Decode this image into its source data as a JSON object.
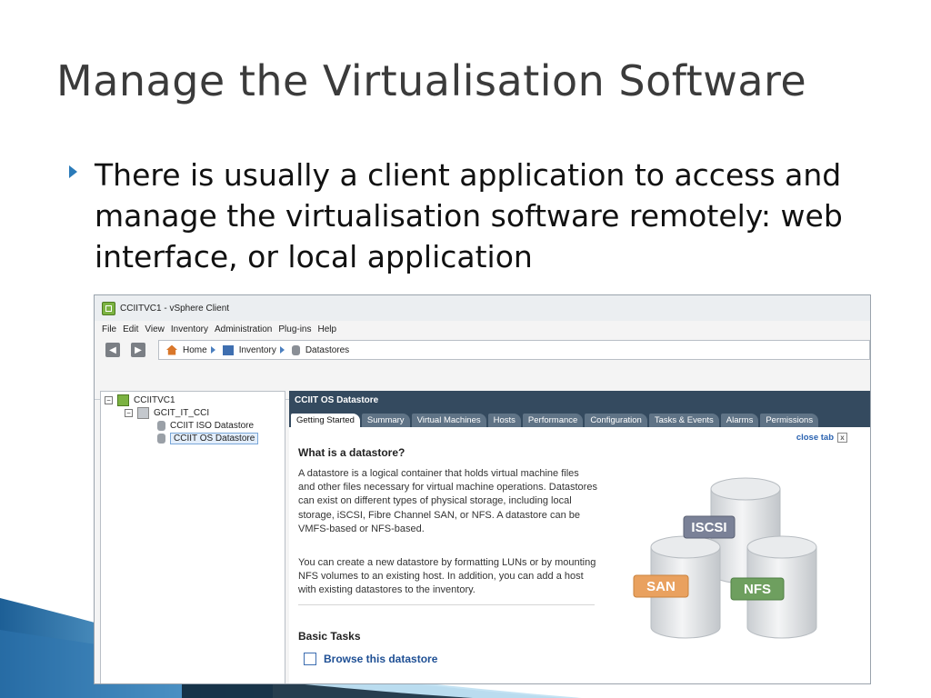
{
  "slide": {
    "title": "Manage the Virtualisation Software",
    "bullet": "There is usually a client application to access and manage the virtualisation software remotely: web interface, or local application"
  },
  "window": {
    "title": "CCIITVC1 - vSphere Client",
    "menu": [
      "File",
      "Edit",
      "View",
      "Inventory",
      "Administration",
      "Plug-ins",
      "Help"
    ],
    "breadcrumb": {
      "home": "Home",
      "inventory": "Inventory",
      "datastores": "Datastores"
    },
    "tree": {
      "root": "CCIITVC1",
      "datacenter": "GCIT_IT_CCI",
      "datastore1": "CCIIT ISO Datastore",
      "datastore2": "CCIIT OS Datastore"
    },
    "panel": {
      "header": "CCIIT OS Datastore",
      "tabs": [
        "Getting Started",
        "Summary",
        "Virtual Machines",
        "Hosts",
        "Performance",
        "Configuration",
        "Tasks & Events",
        "Alarms",
        "Permissions"
      ],
      "active_tab": "Getting Started",
      "close_tab": "close tab",
      "heading": "What is a datastore?",
      "para1": "A datastore is a logical container that holds virtual machine files and other files necessary for virtual machine operations. Datastores can exist on different types of physical storage, including local storage, iSCSI, Fibre Channel SAN, or NFS. A datastore can be VMFS-based or NFS-based.",
      "para2": "You can create a new datastore by formatting LUNs or by mounting NFS volumes to an existing host. In addition, you can add a host with existing datastores to the inventory.",
      "basic_tasks": "Basic Tasks",
      "browse": "Browse this datastore",
      "diagram_labels": {
        "iscsi": "ISCSI",
        "san": "SAN",
        "nfs": "NFS"
      }
    }
  },
  "colors": {
    "title_text": "#3b3b3b",
    "bullet_arrow": "#2b7bb9",
    "panel_header": "#344a5f",
    "link": "#1e4f94",
    "iscsi_badge": "#7a8197",
    "san_badge": "#e9a15f",
    "nfs_badge": "#6e9f5f"
  }
}
